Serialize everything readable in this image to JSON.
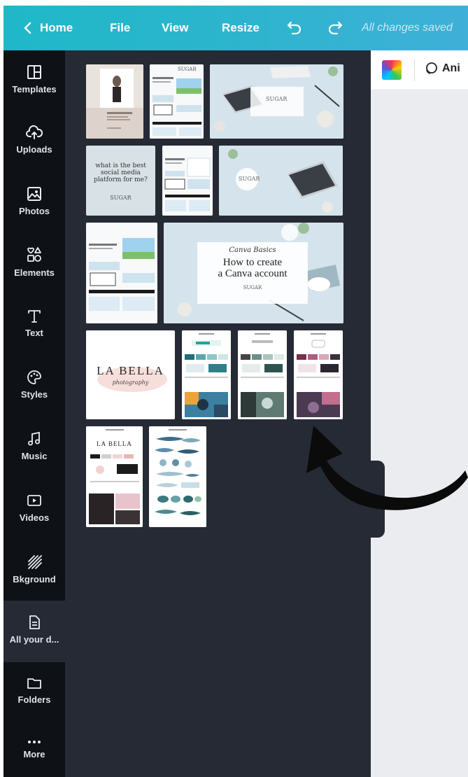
{
  "topbar": {
    "home_label": "Home",
    "file_label": "File",
    "view_label": "View",
    "resize_label": "Resize",
    "save_status": "All changes saved",
    "gradient": [
      "#1fb8c9",
      "#3fb0d8"
    ]
  },
  "sidebar": {
    "items": [
      {
        "label": "Templates",
        "icon": "templates-icon"
      },
      {
        "label": "Uploads",
        "icon": "upload-cloud-icon"
      },
      {
        "label": "Photos",
        "icon": "photo-icon"
      },
      {
        "label": "Elements",
        "icon": "shapes-icon"
      },
      {
        "label": "Text",
        "icon": "text-icon"
      },
      {
        "label": "Styles",
        "icon": "palette-icon"
      },
      {
        "label": "Music",
        "icon": "music-note-icon"
      },
      {
        "label": "Videos",
        "icon": "video-icon"
      },
      {
        "label": "Bkground",
        "icon": "background-icon"
      },
      {
        "label": "All your d...",
        "icon": "document-icon",
        "active": true
      },
      {
        "label": "Folders",
        "icon": "folder-icon"
      },
      {
        "label": "More",
        "icon": "more-dots-icon"
      }
    ]
  },
  "designs": {
    "thumb2_brand": "SUGAR",
    "thumb4_line1": "what is the best",
    "thumb4_line2": "social media",
    "thumb4_line3": "platform for me?",
    "thumb4_brand": "SUGAR",
    "thumb6_brand": "SUGAR",
    "thumb8_script": "Canva Basics",
    "thumb8_line1": "How to create",
    "thumb8_line2": "a Canva account",
    "thumb8_brand": "SUGAR",
    "thumb9_title": "LA BELLA",
    "thumb9_script": "photography",
    "thumb13_title": "LA BELLA"
  },
  "canvas_toolbar": {
    "animate_label": "Ani"
  }
}
